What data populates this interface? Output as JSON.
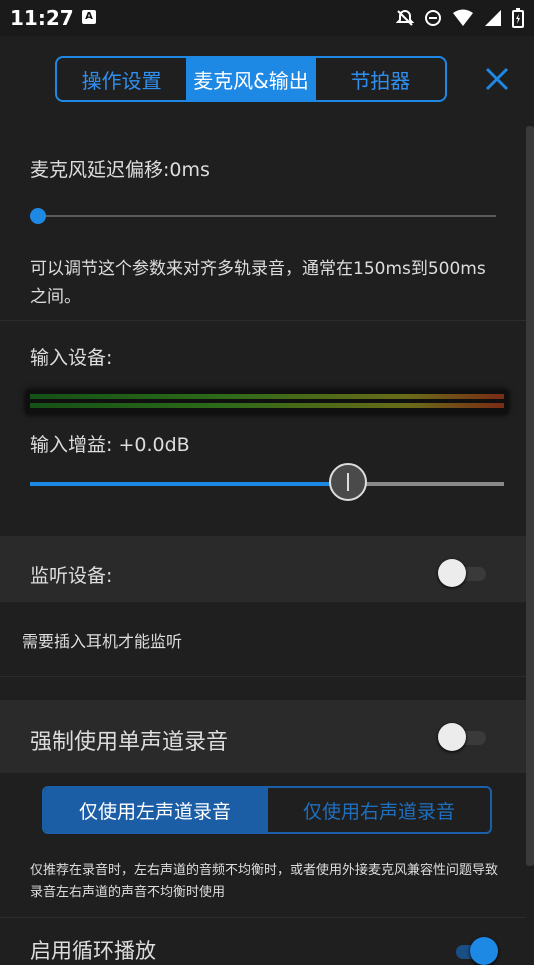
{
  "status": {
    "time": "11:27",
    "a_icon_text": "A"
  },
  "tabs": [
    {
      "label": "操作设置"
    },
    {
      "label": "麦克风&输出"
    },
    {
      "label": "节拍器"
    }
  ],
  "active_tab": "麦克风&输出",
  "mic_delay": {
    "label": "麦克风延迟偏移:0ms",
    "value": 0,
    "description": "可以调节这个参数来对齐多轨录音，通常在150ms到500ms之间。"
  },
  "input_device": {
    "label": "输入设备:"
  },
  "input_gain": {
    "label": "输入增益:  +0.0dB",
    "slider_fraction": 0.67
  },
  "monitor": {
    "label": "监听设备:",
    "enabled": false,
    "hint": "需要插入耳机才能监听"
  },
  "mono": {
    "label": "强制使用单声道录音",
    "enabled": false
  },
  "channel": {
    "left_label": "仅使用左声道录音",
    "right_label": "仅使用右声道录音",
    "selected": "left"
  },
  "note": "仅推荐在录音时，左右声道的音频不均衡时，或者使用外接麦克风兼容性问题导致录音左右声道的声音不均衡时使用",
  "loop": {
    "label": "启用循环播放",
    "enabled": true
  },
  "colors": {
    "accent": "#1e88e5",
    "background": "#1f1f1f",
    "section": "#2a2a2a"
  }
}
